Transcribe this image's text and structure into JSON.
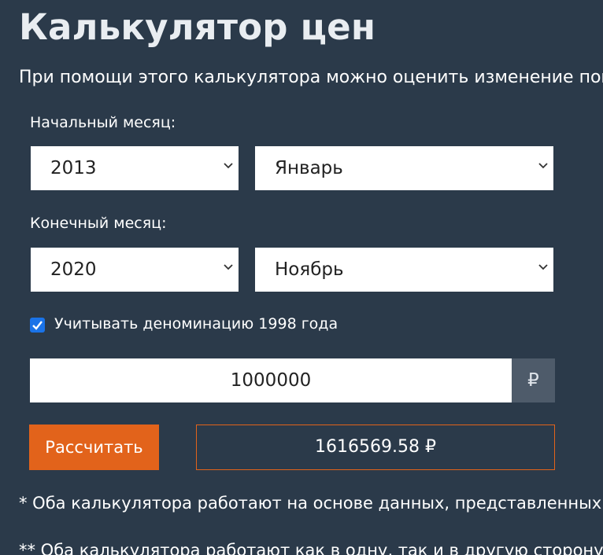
{
  "header": {
    "title": "Калькулятор цен",
    "subtitle": "При помощи этого калькулятора можно оценить изменение поку"
  },
  "form": {
    "start_label": "Начальный месяц:",
    "start_year": "2013",
    "start_month": "Январь",
    "end_label": "Конечный месяц:",
    "end_year": "2020",
    "end_month": "Ноябрь",
    "denomination_checked": true,
    "denomination_label": "Учитывать деноминацию 1998 года",
    "amount_value": "1000000",
    "currency_symbol": "₽",
    "calculate_label": "Рассчитать",
    "result": "1616569.58 ₽"
  },
  "notes": {
    "note1": "* Оба калькулятора работают на основе данных, представленных",
    "note2": "** Оба калькулятора работают как в одну, так и в другую сторону"
  },
  "colors": {
    "background": "#2b3a4a",
    "accent": "#e2631b",
    "checkbox": "#1a73e8",
    "addon": "#4e5b6a"
  },
  "icons": {
    "select_arrow": "chevron-down-icon",
    "checkbox_mark": "checkmark-icon"
  }
}
